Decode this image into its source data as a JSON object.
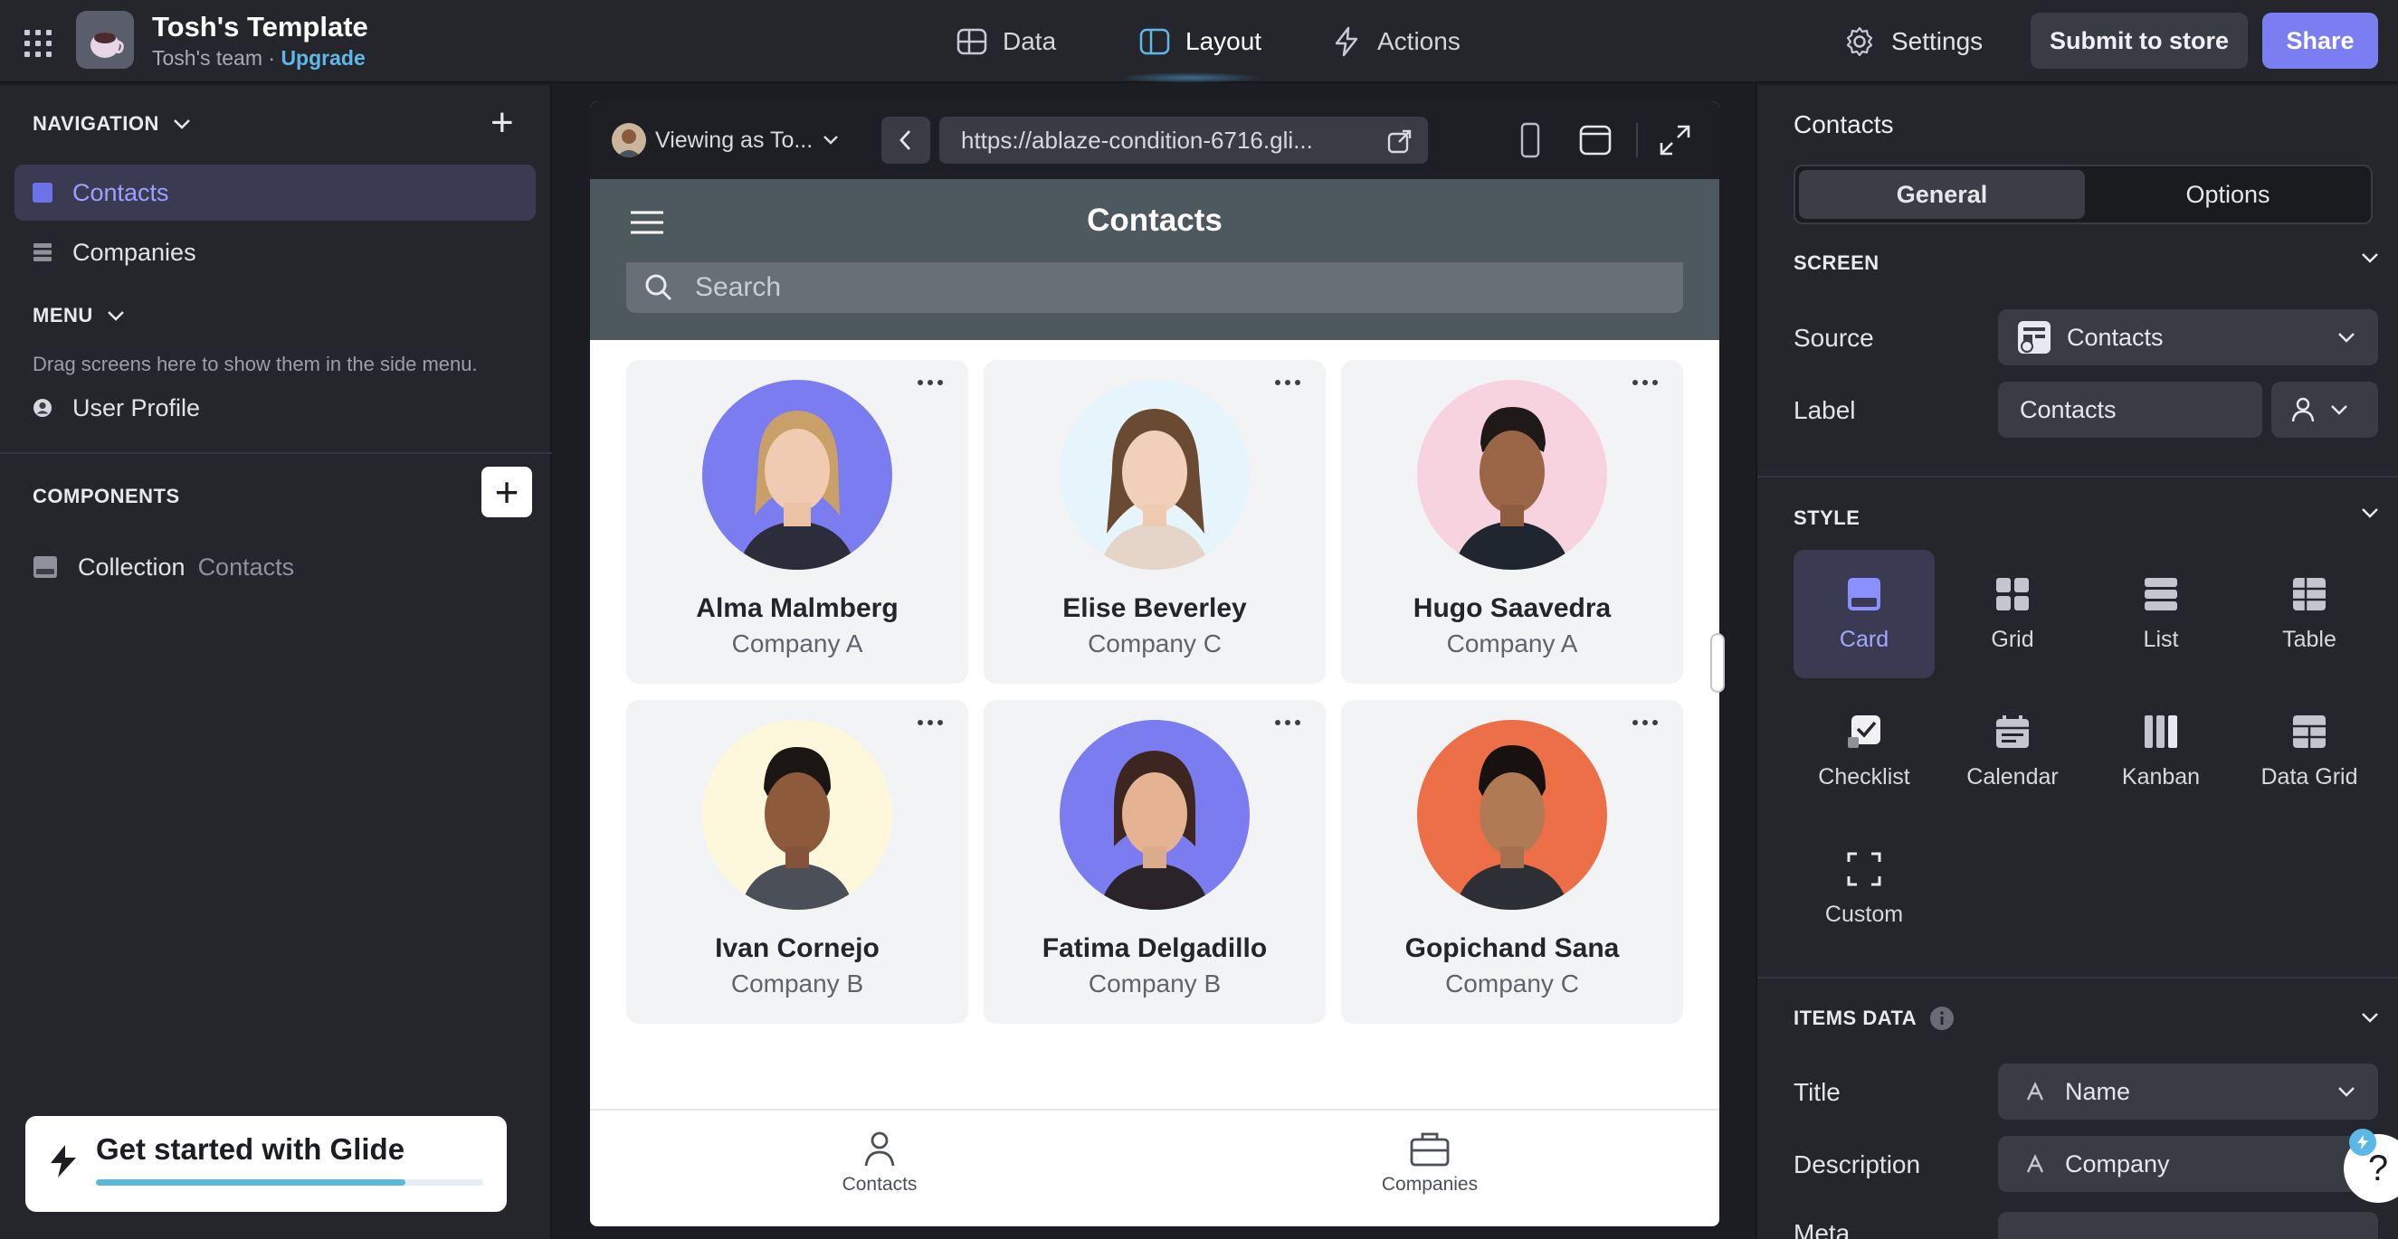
{
  "app": {
    "title": "Tosh's Template",
    "team": "Tosh's team · ",
    "upgrade": "Upgrade"
  },
  "topnav": {
    "data": "Data",
    "layout": "Layout",
    "actions": "Actions",
    "settings": "Settings",
    "submit": "Submit to store",
    "share": "Share"
  },
  "sidebar": {
    "navigation_header": "NAVIGATION",
    "nav_items": [
      "Contacts",
      "Companies"
    ],
    "menu_header": "MENU",
    "menu_hint": "Drag screens here to show them in the side menu.",
    "menu_items": [
      "User Profile"
    ],
    "components_header": "COMPONENTS",
    "component": {
      "name": "Collection",
      "source": "Contacts"
    },
    "get_started": "Get started with Glide",
    "get_started_progress": 0.8
  },
  "preview": {
    "viewing_as": "Viewing as To...",
    "url": "https://ablaze-condition-6716.gli...",
    "screen_title": "Contacts",
    "search_placeholder": "Search",
    "contacts": [
      {
        "name": "Alma Malmberg",
        "company": "Company A",
        "bg": "#7b7cf0"
      },
      {
        "name": "Elise Beverley",
        "company": "Company C",
        "bg": "#e6f4fb"
      },
      {
        "name": "Hugo Saavedra",
        "company": "Company A",
        "bg": "#f7d3df"
      },
      {
        "name": "Ivan Cornejo",
        "company": "Company B",
        "bg": "#fdf8dc"
      },
      {
        "name": "Fatima Delgadillo",
        "company": "Company B",
        "bg": "#7b7cf0"
      },
      {
        "name": "Gopichand Sana",
        "company": "Company C",
        "bg": "#ec6f48"
      }
    ],
    "tabs": [
      "Contacts",
      "Companies"
    ]
  },
  "panel": {
    "title": "Contacts",
    "tabs": [
      "General",
      "Options"
    ],
    "screen_header": "SCREEN",
    "source_label": "Source",
    "source_value": "Contacts",
    "label_label": "Label",
    "label_value": "Contacts",
    "style_header": "STYLE",
    "styles": [
      "Card",
      "Grid",
      "List",
      "Table",
      "Checklist",
      "Calendar",
      "Kanban",
      "Data Grid",
      "Custom"
    ],
    "items_header": "ITEMS DATA",
    "title_label": "Title",
    "title_value": "Name",
    "description_label": "Description",
    "description_value": "Company",
    "meta_label": "Meta"
  },
  "colors": {
    "accent": "#7a7ef0",
    "active_text": "#9aa0ff",
    "app_header": "#4d585f",
    "link": "#5fb8e6"
  }
}
